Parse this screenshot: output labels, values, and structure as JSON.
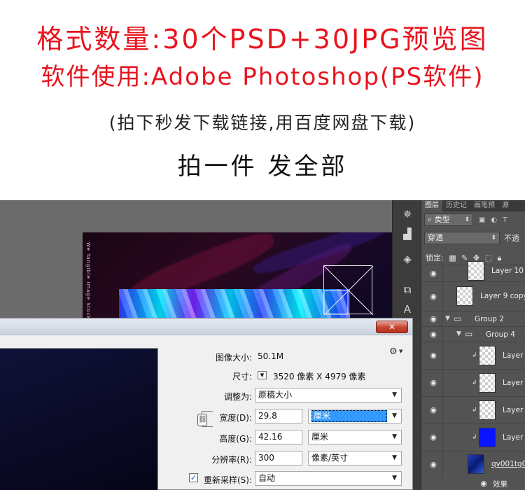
{
  "promo": {
    "line1": "格式数量:30个PSD+30JPG预览图",
    "line2": "软件使用:Adobe Photoshop(PS软件)",
    "line3": "(拍下秒发下载链接,用百度网盘下载)",
    "line4": "拍一件 发全部"
  },
  "canvas": {
    "vertical_text": "We Tangible Image Stock"
  },
  "layers_panel": {
    "tabs": [
      "图层",
      "历史记",
      "画笔预",
      "源"
    ],
    "filter_kind": "类型",
    "blend_mode": "穿透",
    "opacity_label": "不透",
    "lock_label": "锁定:",
    "layers": [
      {
        "name": "Layer 10"
      },
      {
        "name": "Layer 9 copy"
      },
      {
        "name": "Group 2"
      },
      {
        "name": "Group 4"
      },
      {
        "name": "Layer"
      },
      {
        "name": "Layer"
      },
      {
        "name": "Layer"
      },
      {
        "name": "Layer"
      },
      {
        "name": "qv001tg0"
      },
      {
        "name": "效果"
      }
    ]
  },
  "dialog": {
    "close_label": "✕",
    "image_size_label": "图像大小:",
    "image_size_value": "50.1M",
    "dimensions_label": "尺寸:",
    "dimensions_value": "3520 像素  X  4979 像素",
    "fit_to_label": "调整为:",
    "fit_to_value": "原稿大小",
    "width_label": "宽度(D):",
    "width_value": "29.8",
    "width_unit": "厘米",
    "height_label": "高度(G):",
    "height_value": "42.16",
    "height_unit": "厘米",
    "resolution_label": "分辨率(R):",
    "resolution_value": "300",
    "resolution_unit": "像素/英寸",
    "resample_label": "重新采样(S):",
    "resample_value": "自动",
    "resample_checked": true
  },
  "colors": {
    "promo_red": "#e8141e",
    "ps_bg": "#6b6b6b",
    "panel_bg": "#535353",
    "blue_layer": "#0a14ff"
  }
}
